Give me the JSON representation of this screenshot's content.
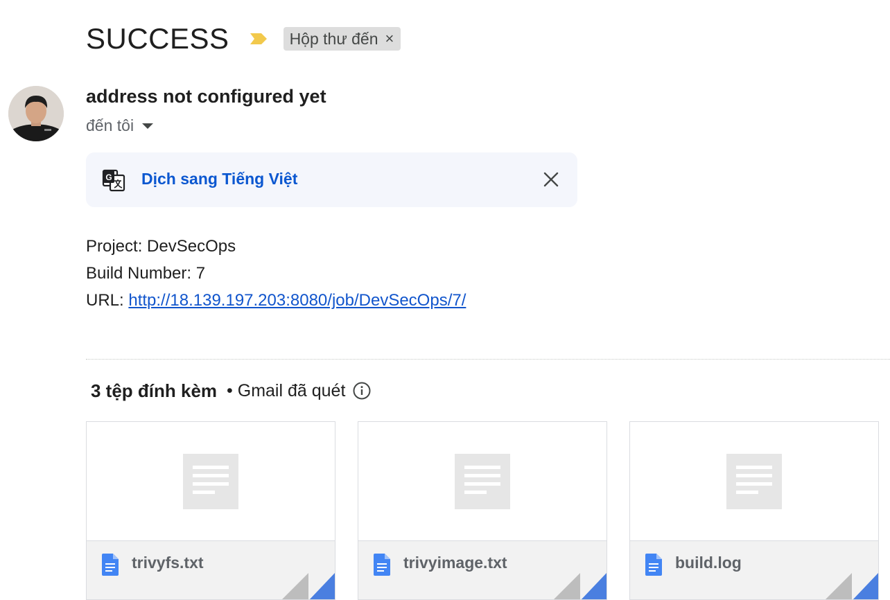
{
  "email": {
    "subject": "SUCCESS",
    "label_chip": "Hộp thư đến",
    "sender_name": "address not configured yet",
    "recipient": "đến tôi"
  },
  "translate": {
    "link_text": "Dịch sang Tiếng Việt"
  },
  "body": {
    "project_line": "Project: DevSecOps",
    "build_line": "Build Number: 7",
    "url_prefix": "URL: ",
    "url_text": "http://18.139.197.203:8080/job/DevSecOps/7/"
  },
  "attachments": {
    "count_label": "3 tệp đính kèm",
    "scan_label": "• Gmail đã quét",
    "files": [
      {
        "name": "trivyfs.txt"
      },
      {
        "name": "trivyimage.txt"
      },
      {
        "name": "build.log"
      }
    ]
  },
  "colors": {
    "link_blue": "#0b57d0",
    "importance_yellow": "#f2c94c",
    "doc_icon_blue": "#4285f4",
    "translate_bg": "#f4f6fc"
  }
}
